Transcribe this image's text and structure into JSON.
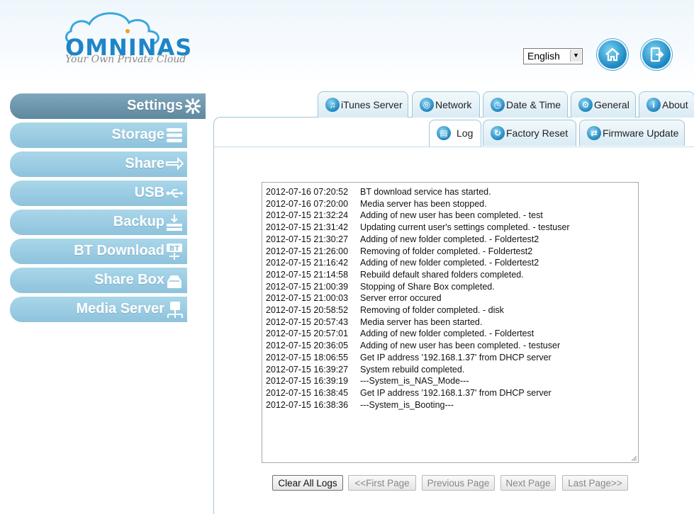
{
  "brand": {
    "name_part1": "OMNI",
    "name_part2": "NAS",
    "tagline": "Your Own Private Cloud"
  },
  "header": {
    "language": "English"
  },
  "sidebar": {
    "items": [
      {
        "label": "Settings",
        "icon": "settings-icon",
        "active": true
      },
      {
        "label": "Storage",
        "icon": "storage-icon"
      },
      {
        "label": "Share",
        "icon": "share-icon"
      },
      {
        "label": "USB",
        "icon": "usb-icon"
      },
      {
        "label": "Backup",
        "icon": "backup-icon"
      },
      {
        "label": "BT Download",
        "icon": "bt-download-icon",
        "icon_text": "BT"
      },
      {
        "label": "Share Box",
        "icon": "share-box-icon"
      },
      {
        "label": "Media Server",
        "icon": "media-server-icon"
      }
    ]
  },
  "tabs_top": [
    {
      "label": "iTunes Server",
      "icon": "itunes-icon",
      "glyph": "♫"
    },
    {
      "label": "Network",
      "icon": "network-icon",
      "glyph": "◎"
    },
    {
      "label": "Date & Time",
      "icon": "clock-icon",
      "glyph": "◷"
    },
    {
      "label": "General",
      "icon": "general-icon",
      "glyph": "⚙"
    },
    {
      "label": "About",
      "icon": "info-icon",
      "glyph": "i"
    }
  ],
  "tabs_sub": [
    {
      "label": "Log",
      "icon": "log-icon",
      "glyph": "▤",
      "selected": true
    },
    {
      "label": "Factory Reset",
      "icon": "reset-icon",
      "glyph": "↻"
    },
    {
      "label": "Firmware Update",
      "icon": "firmware-icon",
      "glyph": "⇄"
    }
  ],
  "log": [
    {
      "time": "2012-07-16 07:20:52",
      "msg": "BT download service has started."
    },
    {
      "time": "2012-07-16 07:20:00",
      "msg": "Media server has been stopped."
    },
    {
      "time": "2012-07-15 21:32:24",
      "msg": "Adding of new user has been completed. - test"
    },
    {
      "time": "2012-07-15 21:31:42",
      "msg": "Updating current user's settings completed. - testuser"
    },
    {
      "time": "2012-07-15 21:30:27",
      "msg": "Adding of new folder completed. - Foldertest2"
    },
    {
      "time": "2012-07-15 21:26:00",
      "msg": "Removing of folder completed. - Foldertest2"
    },
    {
      "time": "2012-07-15 21:16:42",
      "msg": "Adding of new folder completed. - Foldertest2"
    },
    {
      "time": "2012-07-15 21:14:58",
      "msg": "Rebuild default shared folders completed."
    },
    {
      "time": "2012-07-15 21:00:39",
      "msg": "Stopping of Share Box completed."
    },
    {
      "time": "2012-07-15 21:00:03",
      "msg": "Server error occured"
    },
    {
      "time": "2012-07-15 20:58:52",
      "msg": "Removing of folder completed. - disk"
    },
    {
      "time": "2012-07-15 20:57:43",
      "msg": "Media server has been started."
    },
    {
      "time": "2012-07-15 20:57:01",
      "msg": "Adding of new folder completed. - Foldertest"
    },
    {
      "time": "2012-07-15 20:36:05",
      "msg": "Adding of new user has been completed. - testuser"
    },
    {
      "time": "2012-07-15 18:06:55",
      "msg": "Get IP address '192.168.1.37' from DHCP server"
    },
    {
      "time": "2012-07-15 16:39:27",
      "msg": "System rebuild completed."
    },
    {
      "time": "2012-07-15 16:39:19",
      "msg": "---System_is_NAS_Mode---"
    },
    {
      "time": "2012-07-15 16:38:45",
      "msg": "Get IP address '192.168.1.37' from DHCP server"
    },
    {
      "time": "2012-07-15 16:38:36",
      "msg": "---System_is_Booting---"
    }
  ],
  "buttons": {
    "clear": "Clear All Logs",
    "first": "<<First Page",
    "prev": "Previous Page",
    "next": "Next Page",
    "last": "Last Page>>"
  },
  "colors": {
    "brand_blue": "#1e85c8",
    "sidebar": "#9ccde4",
    "sidebar_active": "#6f98ae"
  }
}
